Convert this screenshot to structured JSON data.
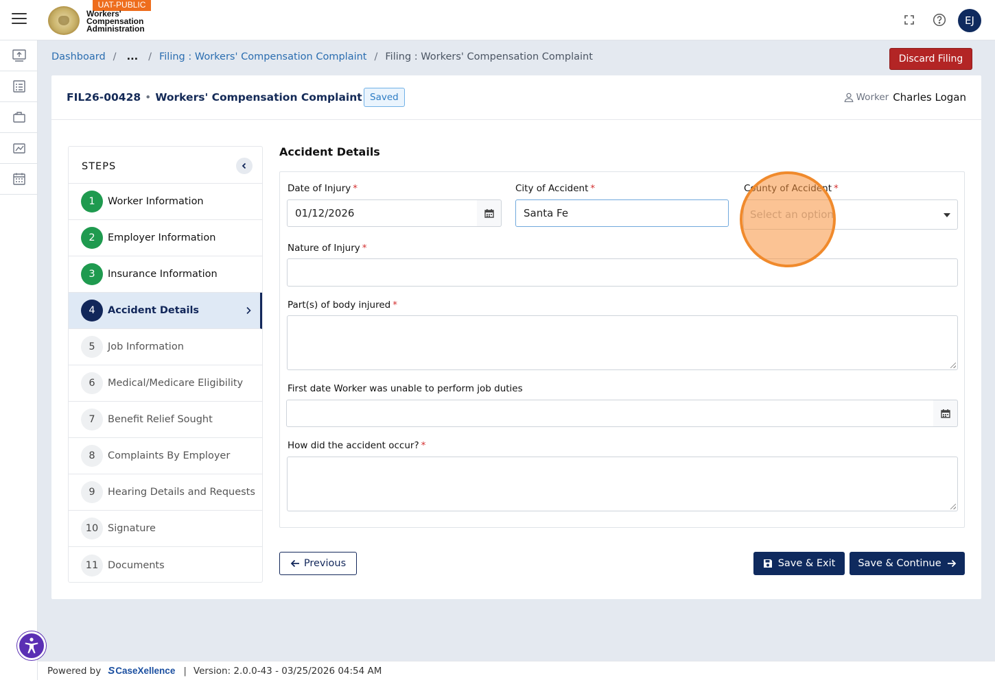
{
  "app": {
    "env_badge": "UAT-PUBLIC",
    "logo_line1": "Workers'",
    "logo_line2": "Compensation",
    "logo_line3": "Administration",
    "user_initials": "EJ"
  },
  "breadcrumb": {
    "dashboard": "Dashboard",
    "ellipsis": "...",
    "filing_link": "Filing : Workers' Compensation Complaint",
    "current": "Filing : Workers' Compensation Complaint"
  },
  "discard_label": "Discard Filing",
  "header": {
    "filing_id": "FIL26-00428",
    "filing_sep": "•",
    "filing_title": "Workers' Compensation Complaint",
    "status": "Saved",
    "worker_label": "Worker",
    "worker_name": "Charles Logan"
  },
  "steps": {
    "title": "STEPS",
    "items": [
      {
        "num": "1",
        "label": "Worker Information",
        "state": "done"
      },
      {
        "num": "2",
        "label": "Employer Information",
        "state": "done"
      },
      {
        "num": "3",
        "label": "Insurance Information",
        "state": "done"
      },
      {
        "num": "4",
        "label": "Accident Details",
        "state": "active"
      },
      {
        "num": "5",
        "label": "Job Information",
        "state": "todo"
      },
      {
        "num": "6",
        "label": "Medical/Medicare Eligibility",
        "state": "todo"
      },
      {
        "num": "7",
        "label": "Benefit Relief Sought",
        "state": "todo"
      },
      {
        "num": "8",
        "label": "Complaints By Employer",
        "state": "todo"
      },
      {
        "num": "9",
        "label": "Hearing Details and Requests",
        "state": "todo"
      },
      {
        "num": "10",
        "label": "Signature",
        "state": "todo"
      },
      {
        "num": "11",
        "label": "Documents",
        "state": "todo"
      }
    ]
  },
  "form": {
    "section_title": "Accident Details",
    "required_mark": "*",
    "date_of_injury": {
      "label": "Date of Injury",
      "value": "01/12/2026"
    },
    "city_of_accident": {
      "label": "City of Accident",
      "value": "Santa Fe"
    },
    "county_of_accident": {
      "label": "County of Accident",
      "placeholder": "Select an option"
    },
    "nature_of_injury": {
      "label": "Nature of Injury",
      "value": ""
    },
    "body_parts": {
      "label": "Part(s) of body injured",
      "value": ""
    },
    "first_unable_date": {
      "label": "First date Worker was unable to perform job duties",
      "value": ""
    },
    "how_occurred": {
      "label": "How did the accident occur?",
      "value": ""
    }
  },
  "buttons": {
    "previous": "Previous",
    "save_exit": "Save & Exit",
    "save_continue": "Save & Continue"
  },
  "footer": {
    "powered_by": "Powered by",
    "brand": "CaseXellence",
    "separator": "|",
    "version": "Version: 2.0.0-43 - 03/25/2026 04:54 AM"
  },
  "colors": {
    "navy": "#0f2a5e",
    "done_green": "#1f9a4f",
    "discard_red": "#b32525",
    "link_blue": "#2a6db0",
    "highlight_orange": "#f08a2c"
  }
}
